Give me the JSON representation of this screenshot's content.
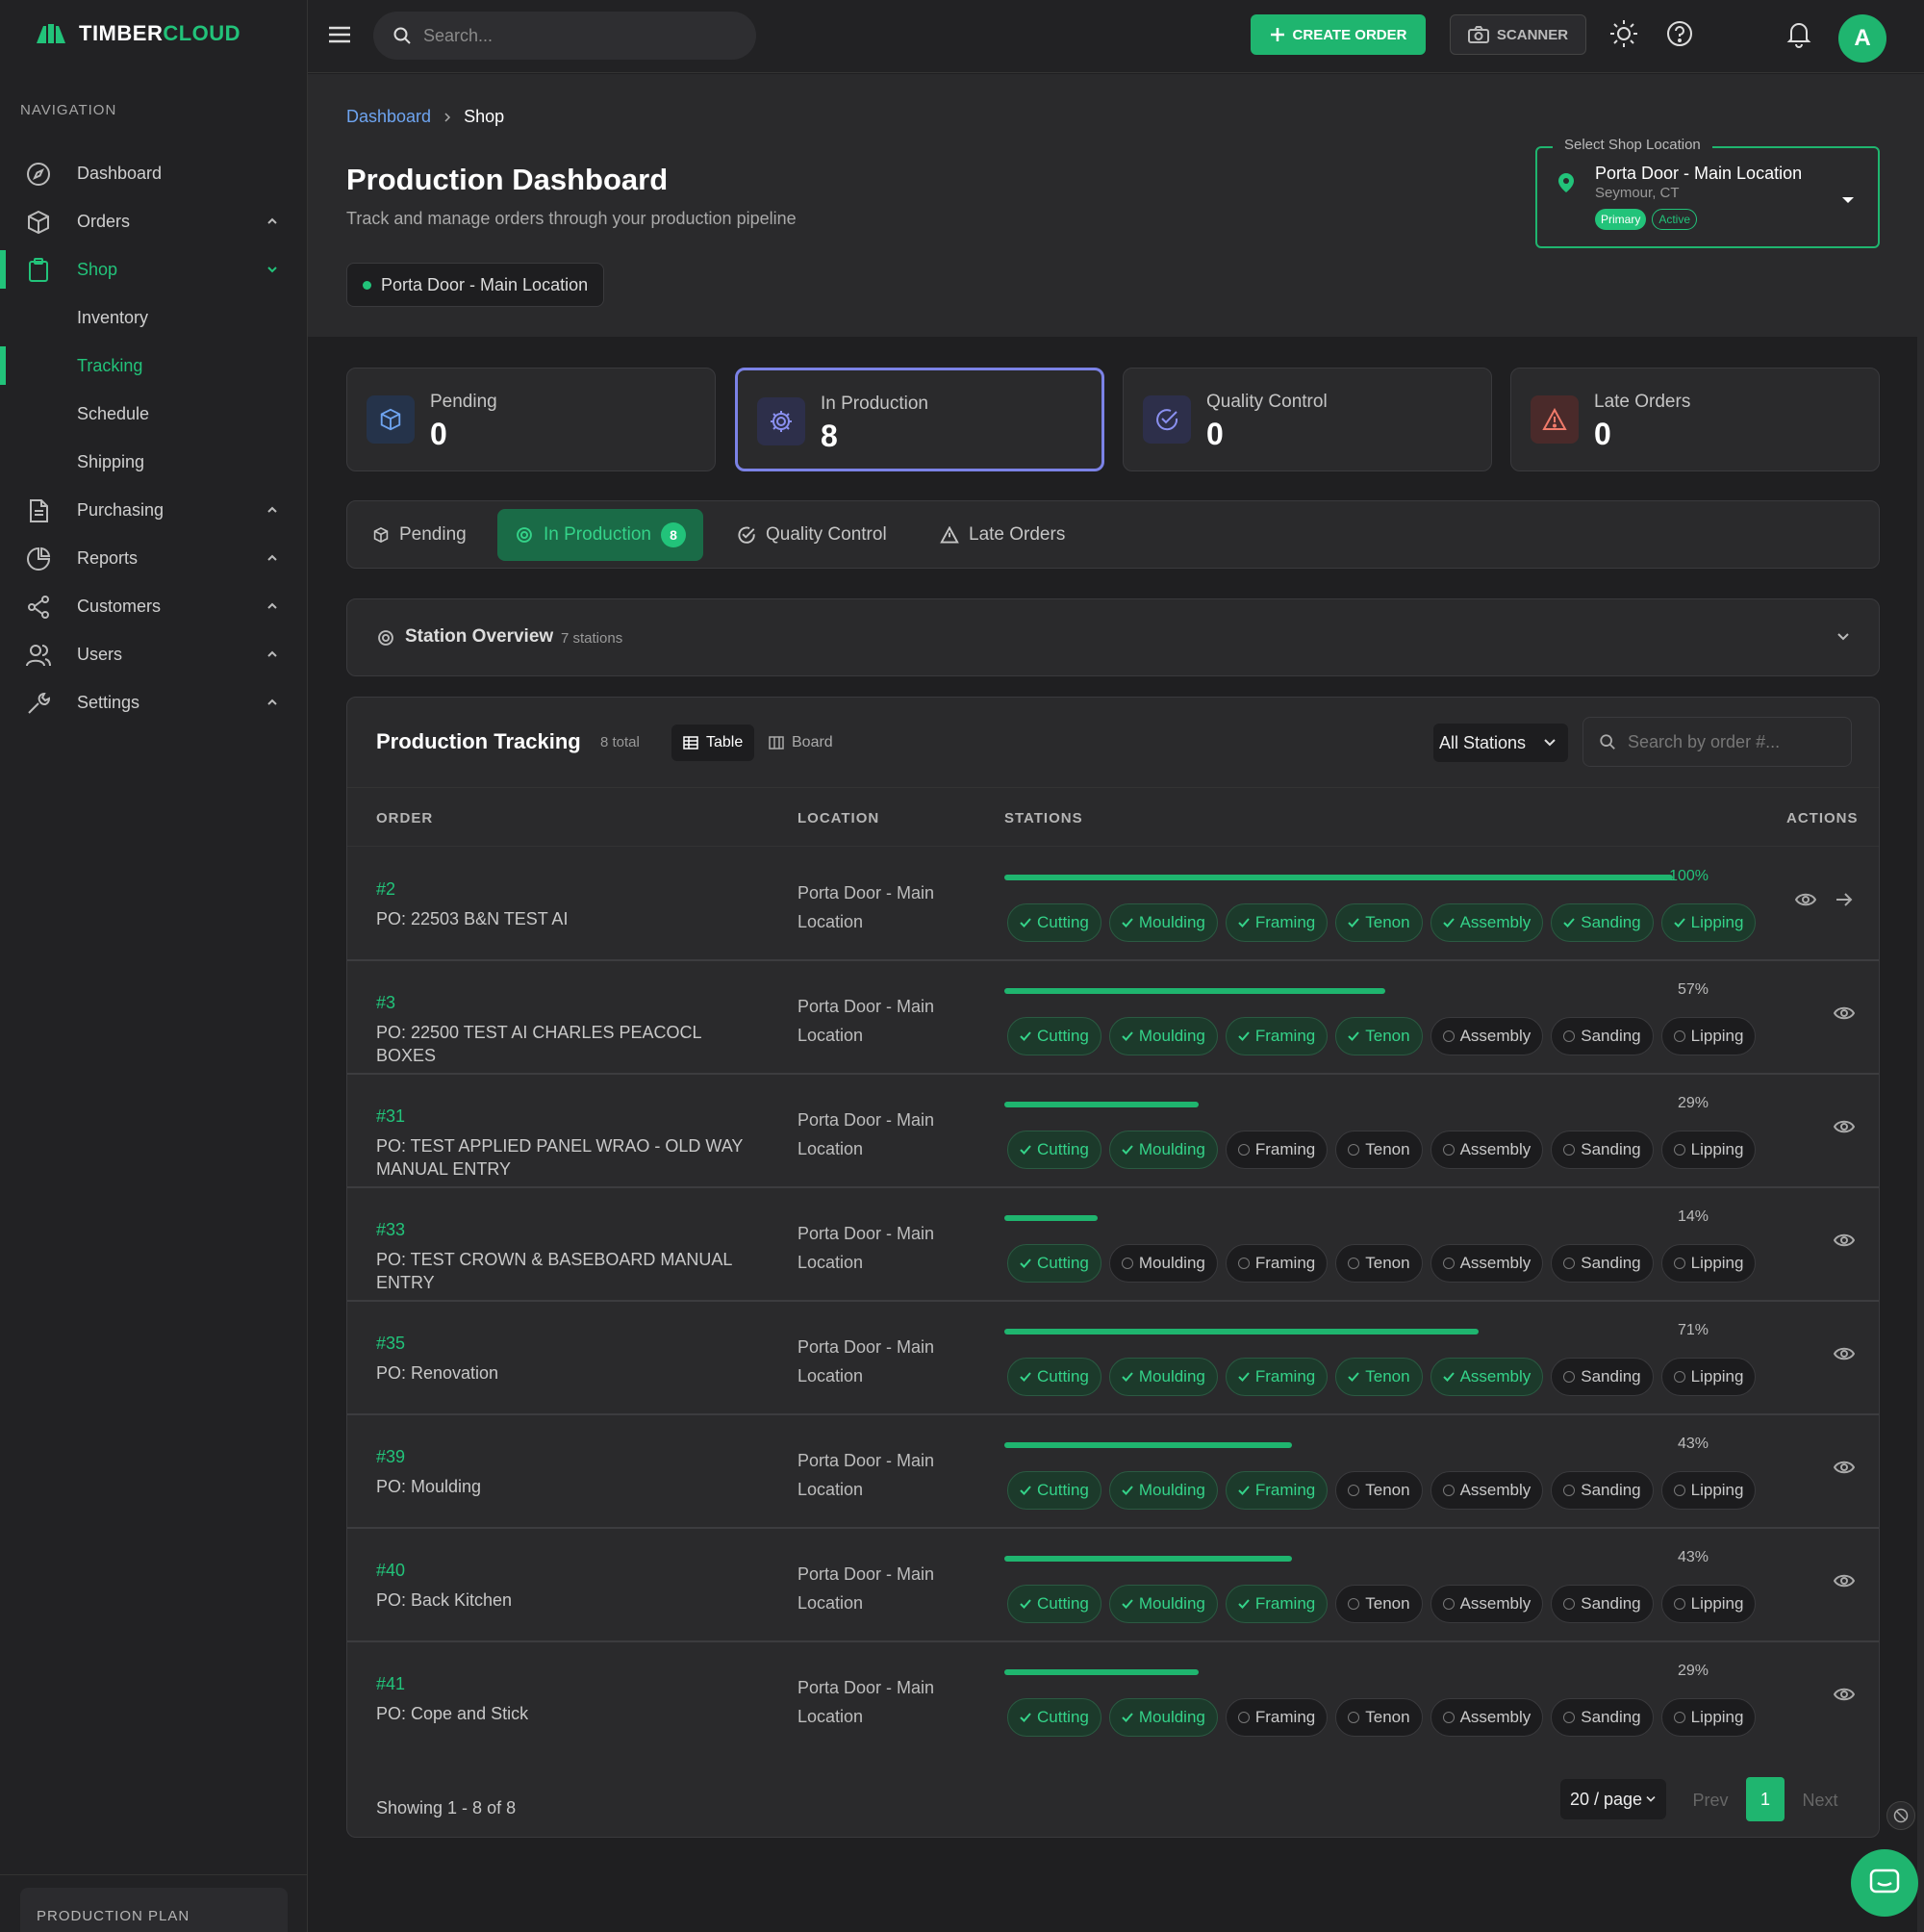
{
  "brand": {
    "name_part1": "TIMBER",
    "name_part2": "CLOUD"
  },
  "sidebar": {
    "nav_title": "NAVIGATION",
    "items": [
      {
        "label": "Dashboard"
      },
      {
        "label": "Orders"
      },
      {
        "label": "Shop"
      },
      {
        "label": "Inventory"
      },
      {
        "label": "Tracking"
      },
      {
        "label": "Schedule"
      },
      {
        "label": "Shipping"
      },
      {
        "label": "Purchasing"
      },
      {
        "label": "Reports"
      },
      {
        "label": "Customers"
      },
      {
        "label": "Users"
      },
      {
        "label": "Settings"
      }
    ],
    "production_plan": "PRODUCTION PLAN"
  },
  "topbar": {
    "search_placeholder": "Search...",
    "create_order": "CREATE ORDER",
    "scanner": "SCANNER",
    "avatar_initial": "A"
  },
  "header": {
    "breadcrumb_home": "Dashboard",
    "breadcrumb_current": "Shop",
    "title": "Production Dashboard",
    "subtitle": "Track and manage orders through your production pipeline",
    "location_pill": "Porta Door - Main Location",
    "location_select": {
      "legend": "Select Shop Location",
      "name": "Porta Door - Main Location",
      "city": "Seymour, CT",
      "badge_primary": "Primary",
      "badge_active": "Active"
    }
  },
  "stats": [
    {
      "label": "Pending",
      "value": "0"
    },
    {
      "label": "In Production",
      "value": "8"
    },
    {
      "label": "Quality Control",
      "value": "0"
    },
    {
      "label": "Late Orders",
      "value": "0"
    }
  ],
  "tabs": [
    {
      "label": "Pending"
    },
    {
      "label": "In Production",
      "count": "8"
    },
    {
      "label": "Quality Control"
    },
    {
      "label": "Late Orders"
    }
  ],
  "overview": {
    "title": "Station Overview",
    "sub": "7 stations"
  },
  "tracking": {
    "title": "Production Tracking",
    "total": "8 total",
    "view_table": "Table",
    "view_board": "Board",
    "station_filter": "All Stations",
    "search_placeholder": "Search by order #...",
    "columns": {
      "order": "ORDER",
      "location": "LOCATION",
      "stations": "STATIONS",
      "actions": "ACTIONS"
    },
    "stations": [
      "Cutting",
      "Moulding",
      "Framing",
      "Tenon",
      "Assembly",
      "Sanding",
      "Lipping"
    ],
    "rows": [
      {
        "order": "#2",
        "po": "PO: 22503 B&N TEST AI",
        "location": "Porta Door - Main Location",
        "progress": 100,
        "pct": "100%",
        "done": 7
      },
      {
        "order": "#3",
        "po": "PO: 22500 TEST AI CHARLES PEACOCL BOXES",
        "location": "Porta Door - Main Location",
        "progress": 57,
        "pct": "57%",
        "done": 4
      },
      {
        "order": "#31",
        "po": "PO: TEST APPLIED PANEL WRAO - OLD WAY MANUAL ENTRY",
        "location": "Porta Door - Main Location",
        "progress": 29,
        "pct": "29%",
        "done": 2
      },
      {
        "order": "#33",
        "po": "PO: TEST CROWN & BASEBOARD MANUAL ENTRY",
        "location": "Porta Door - Main Location",
        "progress": 14,
        "pct": "14%",
        "done": 1
      },
      {
        "order": "#35",
        "po": "PO: Renovation",
        "location": "Porta Door - Main Location",
        "progress": 71,
        "pct": "71%",
        "done": 5
      },
      {
        "order": "#39",
        "po": "PO: Moulding",
        "location": "Porta Door - Main Location",
        "progress": 43,
        "pct": "43%",
        "done": 3
      },
      {
        "order": "#40",
        "po": "PO: Back Kitchen",
        "location": "Porta Door - Main Location",
        "progress": 43,
        "pct": "43%",
        "done": 3
      },
      {
        "order": "#41",
        "po": "PO: Cope and Stick",
        "location": "Porta Door - Main Location",
        "progress": 29,
        "pct": "29%",
        "done": 2
      }
    ],
    "pagination": {
      "info": "Showing 1 - 8 of 8",
      "per_page": "20 / page",
      "prev": "Prev",
      "page": "1",
      "next": "Next"
    }
  },
  "colors": {
    "accent": "#1fb56f",
    "selected_card_border": "#7b82e6"
  }
}
